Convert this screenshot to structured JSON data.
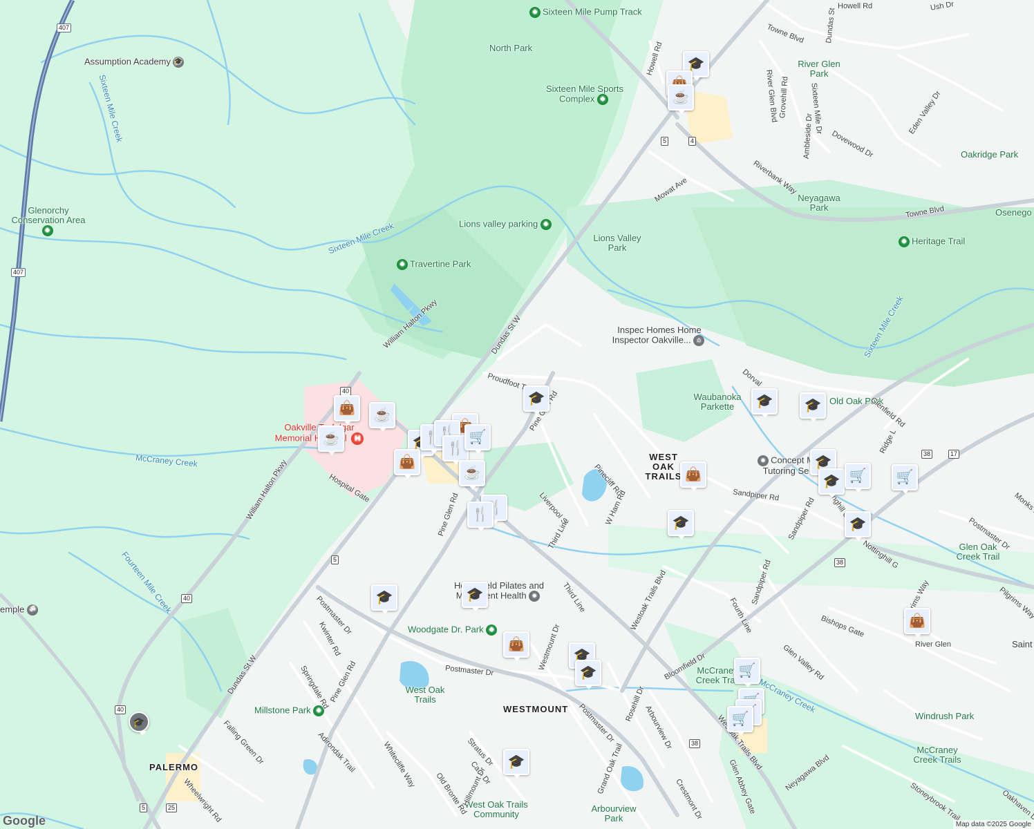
{
  "colors": {
    "park": "#cdf3df",
    "park_dark": "#b7ebcf",
    "water": "#8fd2f0",
    "road": "#ffffff",
    "arterial": "#c9d1d9",
    "highway": "#5f7aa8",
    "urban": "#f3f4f4",
    "marker_fill": "#e8f0fe",
    "marker_icon": "#0b3d6b"
  },
  "place_labels": [
    {
      "text": "Sixteen Mile Pump Track",
      "kind": "park-poi"
    },
    {
      "text": "North Park",
      "kind": "park"
    },
    {
      "text": "Assumption Academy",
      "kind": "school-poi"
    },
    {
      "text": "Sixteen Mile Sports Complex",
      "kind": "park-poi"
    },
    {
      "text": "Glenorchy Conservation Area",
      "kind": "park-poi"
    },
    {
      "text": "Lions valley parking",
      "kind": "park-poi"
    },
    {
      "text": "Lions Valley Park",
      "kind": "park"
    },
    {
      "text": "Travertine Park",
      "kind": "park-poi"
    },
    {
      "text": "River Glen Park",
      "kind": "park"
    },
    {
      "text": "Oakridge Park",
      "kind": "park"
    },
    {
      "text": "Neyagawa Park",
      "kind": "park"
    },
    {
      "text": "Heritage Trail",
      "kind": "park-poi"
    },
    {
      "text": "Osenego",
      "kind": "park"
    },
    {
      "text": "Inspec Homes Home Inspector Oakville...",
      "kind": "business"
    },
    {
      "text": "Waubanoka Parkette",
      "kind": "park"
    },
    {
      "text": "Old Oak Park",
      "kind": "park"
    },
    {
      "text": "Oakville Trafalgar Memorial Hospital",
      "kind": "hospital"
    },
    {
      "text": "Concept M Tutoring Se",
      "kind": "business"
    },
    {
      "text": "WEST OAK TRAILS",
      "kind": "neighbourhood"
    },
    {
      "text": "Glen Oak Creek Trail",
      "kind": "park"
    },
    {
      "text": "Hesterfield Pilates and Movement Health",
      "kind": "business"
    },
    {
      "text": "Woodgate Dr. Park",
      "kind": "park-poi"
    },
    {
      "text": "West Oak Trails",
      "kind": "park"
    },
    {
      "text": "WESTMOUNT",
      "kind": "neighbourhood"
    },
    {
      "text": "Millstone Park",
      "kind": "park-poi"
    },
    {
      "text": "PALERMO",
      "kind": "neighbourhood"
    },
    {
      "text": "McCraney Creek Trail",
      "kind": "park"
    },
    {
      "text": "Windrush Park",
      "kind": "park"
    },
    {
      "text": "McCraney Creek Trails",
      "kind": "park"
    },
    {
      "text": "Arbourview Park",
      "kind": "park"
    },
    {
      "text": "West Oak Trails Community",
      "kind": "park"
    },
    {
      "text": "emple",
      "kind": "business"
    },
    {
      "text": "Saint",
      "kind": "business"
    }
  ],
  "water_labels": [
    "Sixteen Mile Creek",
    "Sixteen Mile Creek",
    "Sixteen Mile Creek",
    "McCraney Creek",
    "Fourteen Mile Creek",
    "McCraney Creek"
  ],
  "street_labels": [
    "Dundas St W",
    "Dundas St W",
    "William Halton Pkwy",
    "William Halton Pkwy",
    "Hospital Gate",
    "Proudfoot Trail",
    "Pine Glen Rd",
    "Pine Glen Rd",
    "Pine Glen Rd",
    "Oakhaven Dr",
    "Pinecliff Rd",
    "W Ham Rd",
    "Liverpool St",
    "Third Line",
    "Third Line",
    "Westoak Trails Blvd",
    "Westoak Trails Blvd",
    "Glenfield Rd",
    "Sandpiper Rd",
    "Sandpiper Rd",
    "Sandpiper Rd",
    "Bloomfield Dr",
    "Fourth Line",
    "Nottinghill Gate",
    "Nottinghill G",
    "Pilgrims Way",
    "Pilgrims Way",
    "Stoneybrook Trail",
    "Bishops Gate",
    "Glen Valley Rd",
    "Ridge L",
    "Dorval",
    "Monks Passage",
    "Postmaster Dr",
    "Postmaster Dr",
    "Postmaster Dr",
    "Postmaster Dr",
    "Crestmont Dr",
    "Kwinter Rd",
    "Springdale Rd",
    "Westmount Dr",
    "Rosehill Dr",
    "Arbourview Dr",
    "Grand Oak Trail",
    "Falling Green Dr",
    "Adirondak Trail",
    "Whitecliffe Way",
    "Stratus Dr",
    "Carn Dr",
    "Hillmount Dr",
    "Old Bronte Rd",
    "Wheelwright Rd",
    "Glen Abbey Gate",
    "Neyagawa Blvd",
    "Towne Blvd",
    "Towne Blvd",
    "Eden Valley Dr",
    "Riverbank Way",
    "Mowat Ave",
    "Dovewood Dr",
    "Ambleside Dr",
    "Grovehill Rd",
    "River Glen Blvd",
    "Sixteen Mile Dr",
    "Howell Rd",
    "Howell Rd",
    "Ush Dr",
    "River Glen",
    "Dundas St"
  ],
  "route_shields": [
    "407",
    "407",
    "5",
    "4",
    "40",
    "40",
    "40",
    "5",
    "5",
    "25",
    "38",
    "17",
    "38",
    "38"
  ],
  "markers": [
    {
      "icon": "school-icon",
      "glyph": "🎓"
    },
    {
      "icon": "shopping-bag-icon",
      "glyph": "👜"
    },
    {
      "icon": "coffee-icon",
      "glyph": "☕"
    },
    {
      "icon": "shopping-bag-icon",
      "glyph": "👜"
    },
    {
      "icon": "coffee-icon",
      "glyph": "☕"
    },
    {
      "icon": "coffee-icon",
      "glyph": "☕"
    },
    {
      "icon": "shopping-bag-icon",
      "glyph": "👜"
    },
    {
      "icon": "school-icon",
      "glyph": "🎓"
    },
    {
      "icon": "restaurant-icon",
      "glyph": "🍴"
    },
    {
      "icon": "restaurant-icon",
      "glyph": "🍴"
    },
    {
      "icon": "restaurant-icon",
      "glyph": "🍴"
    },
    {
      "icon": "shopping-cart-icon",
      "glyph": "🛒"
    },
    {
      "icon": "shopping-bag-icon",
      "glyph": "👜"
    },
    {
      "icon": "coffee-icon",
      "glyph": "☕"
    },
    {
      "icon": "restaurant-icon",
      "glyph": "🍴"
    },
    {
      "icon": "restaurant-icon",
      "glyph": "🍴"
    },
    {
      "icon": "school-icon",
      "glyph": "🎓"
    },
    {
      "icon": "school-icon",
      "glyph": "🎓"
    },
    {
      "icon": "school-icon",
      "glyph": "🎓"
    },
    {
      "icon": "shopping-bag-icon",
      "glyph": "👜"
    },
    {
      "icon": "school-icon",
      "glyph": "🎓"
    },
    {
      "icon": "school-icon",
      "glyph": "🎓"
    },
    {
      "icon": "school-icon",
      "glyph": "🎓"
    },
    {
      "icon": "shopping-cart-icon",
      "glyph": "🛒"
    },
    {
      "icon": "shopping-cart-icon",
      "glyph": "🛒"
    },
    {
      "icon": "school-icon",
      "glyph": "🎓"
    },
    {
      "icon": "school-icon",
      "glyph": "🎓"
    },
    {
      "icon": "shopping-bag-icon",
      "glyph": "👜"
    },
    {
      "icon": "school-icon",
      "glyph": "🎓"
    },
    {
      "icon": "school-icon",
      "glyph": "🎓"
    },
    {
      "icon": "shopping-bag-icon",
      "glyph": "👜"
    },
    {
      "icon": "school-icon",
      "glyph": "🎓"
    },
    {
      "icon": "school-icon",
      "glyph": "🎓"
    },
    {
      "icon": "shopping-cart-icon",
      "glyph": "🛒"
    },
    {
      "icon": "shopping-cart-icon",
      "glyph": "🛒"
    },
    {
      "icon": "shopping-cart-icon",
      "glyph": "🛒"
    },
    {
      "icon": "shopping-cart-icon",
      "glyph": "🛒"
    },
    {
      "icon": "school-icon",
      "glyph": "🎓"
    }
  ],
  "brand": "Google",
  "attribution": "Map data ©2025 Google"
}
